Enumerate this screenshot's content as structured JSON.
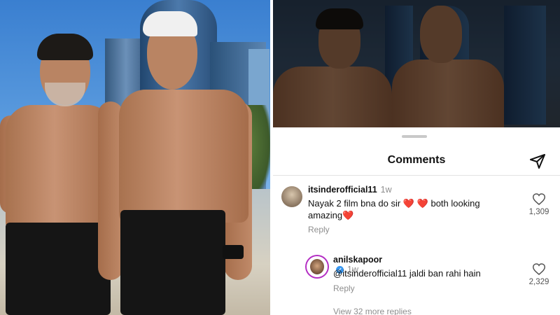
{
  "sheet": {
    "title": "Comments"
  },
  "comments": [
    {
      "username": "itsinderofficial11",
      "time": "1w",
      "text": "Nayak 2 film bna do sir",
      "text_hearts_1": "❤️ ❤️",
      "text_rest": " both looking amazing",
      "text_heart_2": "❤️",
      "reply_label": "Reply",
      "likes": "1,309",
      "verified": false
    },
    {
      "username": "anilskapoor",
      "time": "1w",
      "text": "@itsinderofficial11 jaldi ban rahi hain",
      "reply_label": "Reply",
      "likes": "2,329",
      "verified": true,
      "verified_mark": "✓"
    }
  ],
  "view_more": "View 32 more replies",
  "colors": {
    "heart": "#e0245e",
    "verified": "#3897f0",
    "story_ring": "#b42fc4"
  }
}
